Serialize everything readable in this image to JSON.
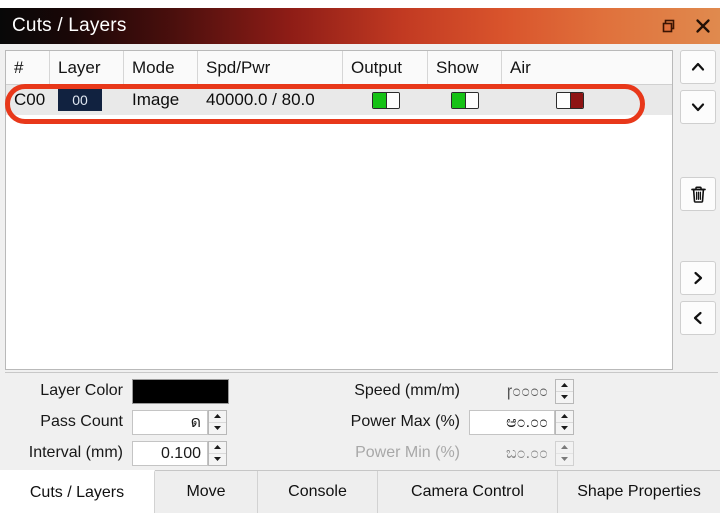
{
  "window": {
    "title": "Cuts / Layers",
    "buttons": [
      {
        "name": "undock-button",
        "icon": "undock-icon"
      },
      {
        "name": "close-button",
        "icon": "close-icon"
      }
    ]
  },
  "table": {
    "columns": [
      {
        "key": "num",
        "label": "#",
        "width": 44
      },
      {
        "key": "layer",
        "label": "Layer",
        "width": 74
      },
      {
        "key": "mode",
        "label": "Mode",
        "width": 74
      },
      {
        "key": "spdpwr",
        "label": "Spd/Pwr",
        "width": 145
      },
      {
        "key": "output",
        "label": "Output",
        "width": 85
      },
      {
        "key": "show",
        "label": "Show",
        "width": 74
      },
      {
        "key": "air",
        "label": "Air",
        "width": 170
      }
    ],
    "rows": [
      {
        "num": "C00",
        "layer_swatch": "00",
        "layer_swatch_color": "#112240",
        "mode": "Image",
        "spdpwr": "40000.0 / 80.0",
        "output": "on",
        "show": "on",
        "air": "off"
      }
    ]
  },
  "annotation": {
    "shape": "red-ellipse-highlight",
    "color": "#e8381a"
  },
  "sidebar": {
    "buttons": [
      {
        "name": "move-up-button",
        "icon": "chevron-up-icon"
      },
      {
        "name": "move-down-button",
        "icon": "chevron-down-icon"
      },
      {
        "name": "delete-button",
        "icon": "trash-icon"
      },
      {
        "name": "move-right-button",
        "icon": "chevron-right-icon"
      },
      {
        "name": "move-left-button",
        "icon": "chevron-left-icon"
      }
    ]
  },
  "settings": {
    "layer_color": {
      "label": "Layer Color",
      "value": "#000000"
    },
    "pass_count": {
      "label": "Pass Count",
      "value": "ด"
    },
    "interval": {
      "label": "Interval (mm)",
      "value": "0.100"
    },
    "speed": {
      "label": "Speed (mm/m)",
      "value": "ɼ೦೦೦೦"
    },
    "power_max": {
      "label": "Power Max (%)",
      "value": "ಆ೦.೦೦"
    },
    "power_min": {
      "label": "Power Min (%)",
      "value": "ಬ೦.೦೦",
      "disabled": true
    }
  },
  "tabs": [
    {
      "label": "Cuts / Layers",
      "active": true
    },
    {
      "label": "Move",
      "active": false
    },
    {
      "label": "Console",
      "active": false
    },
    {
      "label": "Camera Control",
      "active": false
    },
    {
      "label": "Shape Properties",
      "active": false
    }
  ]
}
